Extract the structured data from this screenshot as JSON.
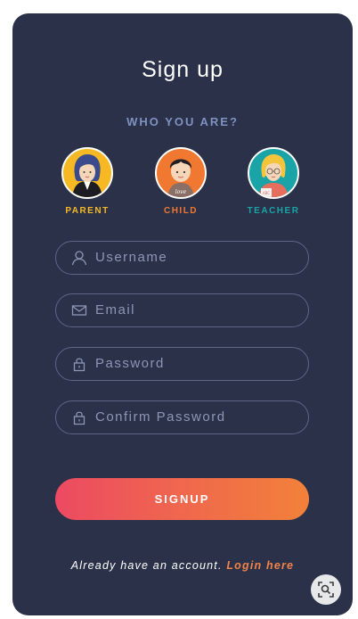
{
  "status_bar": {
    "text": ""
  },
  "header": {
    "title": "Sign up",
    "subtitle": "WHO YOU ARE?"
  },
  "roles": [
    {
      "label": "PARENT",
      "color": "#f7b923"
    },
    {
      "label": "CHILD",
      "color": "#f07830"
    },
    {
      "label": "TEACHER",
      "color": "#1aa4a8"
    }
  ],
  "form": {
    "username_placeholder": "Username",
    "email_placeholder": "Email",
    "password_placeholder": "Password",
    "confirm_password_placeholder": "Confirm Password"
  },
  "signup_button": {
    "label": "SIGNUP"
  },
  "footer": {
    "text": "Already have an account. ",
    "link": "Login here"
  },
  "icons": [
    "user-icon",
    "mail-icon",
    "lock-icon",
    "lock-icon",
    "lens-search-icon"
  ],
  "colors": {
    "background": "#2a3148",
    "accent_start": "#ec4a62",
    "accent_end": "#f2813a",
    "field_border": "#5d6784"
  }
}
